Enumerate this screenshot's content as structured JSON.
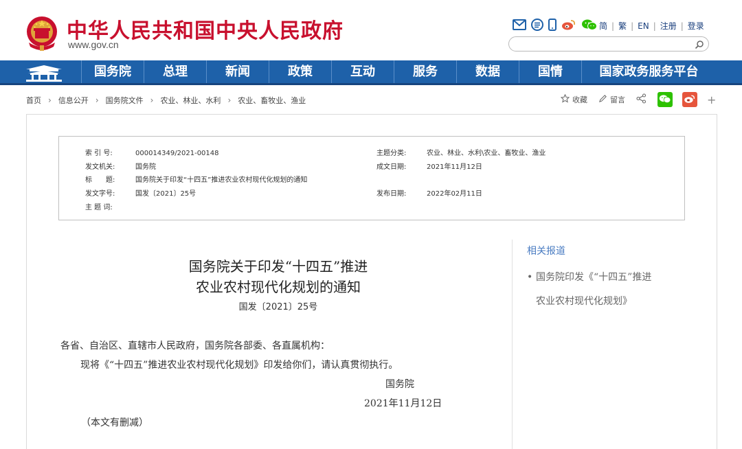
{
  "header": {
    "site_title": "中华人民共和国中央人民政府",
    "site_domain": "www.gov.cn",
    "icons": [
      "mail-icon",
      "rss-icon",
      "mobile-icon",
      "weibo-icon",
      "wechat-icon"
    ],
    "lang_links": [
      "简",
      "繁",
      "EN",
      "注册",
      "登录"
    ],
    "search_placeholder": ""
  },
  "nav": {
    "items": [
      "国务院",
      "总理",
      "新闻",
      "政策",
      "互动",
      "服务",
      "数据",
      "国情",
      "国家政务服务平台"
    ]
  },
  "breadcrumb": [
    "首页",
    "信息公开",
    "国务院文件",
    "农业、林业、水利",
    "农业、畜牧业、渔业"
  ],
  "actions": {
    "favorite": "收藏",
    "comment": "留言"
  },
  "meta": {
    "index_label": "索 引 号:",
    "index_value": "000014349/2021-00148",
    "topic_label": "主题分类:",
    "topic_value": "农业、林业、水利\\农业、畜牧业、渔业",
    "issuer_label": "发文机关:",
    "issuer_value": "国务院",
    "date_written_label": "成文日期:",
    "date_written_value": "2021年11月12日",
    "title_label": "标　　题:",
    "title_value": "国务院关于印发“十四五”推进农业农村现代化规划的通知",
    "doc_no_label": "发文字号:",
    "doc_no_value": "国发〔2021〕25号",
    "publish_label": "发布日期:",
    "publish_value": "2022年02月11日",
    "keywords_label": "主 题 词:",
    "keywords_value": ""
  },
  "article": {
    "title_line1": "国务院关于印发“十四五”推进",
    "title_line2": "农业农村现代化规划的通知",
    "doc_no": "国发〔2021〕25号",
    "salutation": "各省、自治区、直辖市人民政府，国务院各部委、各直属机构：",
    "body": "现将《“十四五”推进农业农村现代化规划》印发给你们，请认真贯彻执行。",
    "signer": "国务院",
    "date": "2021年11月12日",
    "note": "（本文有删减）"
  },
  "sidebar": {
    "title": "相关报道",
    "items": [
      {
        "line1": "国务院印发《“十四五”推进",
        "line2": "农业农村现代化规划》"
      }
    ]
  },
  "colors": {
    "brand_red": "#c8102e",
    "nav_blue": "#1e61a9",
    "link_blue": "#4a7cc2",
    "wechat_green": "#2dc100",
    "weibo_red": "#e6553c"
  }
}
